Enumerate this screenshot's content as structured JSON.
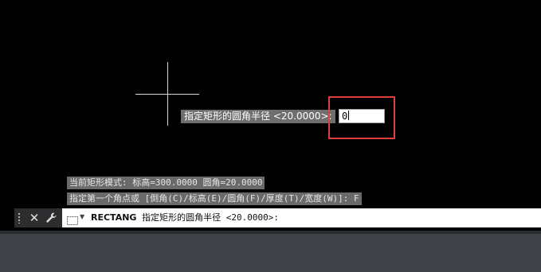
{
  "dynamic_input": {
    "prompt": "指定矩形的圆角半径 <20.0000>:",
    "value": "0"
  },
  "history": {
    "line1": "当前矩形模式:  标高=300.0000  圆角=20.0000",
    "line2": "指定第一个角点或 [倒角(C)/标高(E)/圆角(F)/厚度(T)/宽度(W)]: F"
  },
  "command_line": {
    "command": "RECTANG",
    "prompt": "指定矩形的圆角半径 <20.0000>:"
  },
  "icons": {
    "close": "close-icon",
    "customize": "wrench-icon",
    "command": "command-line-icon",
    "dropdown": "chevron-down-icon"
  },
  "colors": {
    "highlight": "#d94040",
    "canvas": "#000000"
  }
}
